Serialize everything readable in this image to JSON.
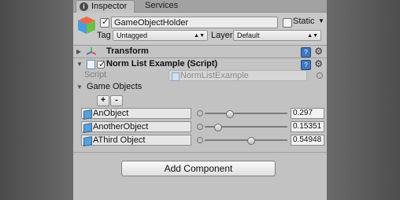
{
  "tabs": {
    "inspector": "Inspector",
    "services": "Services"
  },
  "gameobject": {
    "active": true,
    "name": "GameObjectHolder",
    "static_label": "Static",
    "static_checked": false,
    "tag_label": "Tag",
    "tag_value": "Untagged",
    "layer_label": "Layer",
    "layer_value": "Default"
  },
  "components": {
    "transform": {
      "title": "Transform"
    },
    "script": {
      "title": "Norm List Example (Script)",
      "enabled": true,
      "script_label": "Script",
      "script_value": "NormListExample"
    }
  },
  "list": {
    "title": "Game Objects",
    "add_label": "+",
    "remove_label": "-",
    "rows": [
      {
        "object": "AnObject",
        "value": "0.297",
        "fraction": 0.297
      },
      {
        "object": "AnotherObject",
        "value": "0.15351",
        "fraction": 0.15351
      },
      {
        "object": "AThird Object",
        "value": "0.54948",
        "fraction": 0.54948
      }
    ]
  },
  "add_component": "Add Component",
  "colors": {
    "panel": "#c2c2c2",
    "help": "#3f77c0",
    "cube": "#5aa0d8"
  }
}
